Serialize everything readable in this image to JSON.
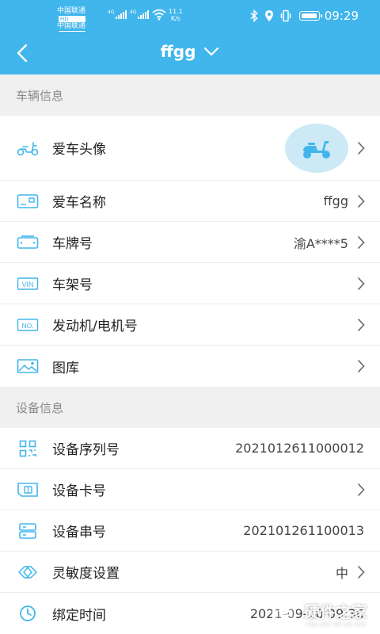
{
  "status_bar": {
    "carrier_1": "中国联通",
    "carrier_2": "中国联通",
    "hd_badge": "HD",
    "network_1": "4G",
    "network_2": "4G",
    "speed_value": "11.1",
    "speed_unit": "K/s",
    "time": "09:29"
  },
  "header": {
    "back_icon": "chevron-left-icon",
    "title": "ffgg",
    "dropdown_icon": "chevron-down-icon"
  },
  "vehicle_section": {
    "title": "车辆信息",
    "rows": [
      {
        "label": "爱车头像",
        "value": "",
        "icon": "scooter-icon"
      },
      {
        "label": "爱车名称",
        "value": "ffgg",
        "icon": "card-icon"
      },
      {
        "label": "车牌号",
        "value": "渝A****5",
        "icon": "license-plate-icon"
      },
      {
        "label": "车架号",
        "value": "",
        "icon": "vin-icon"
      },
      {
        "label": "发动机/电机号",
        "value": "",
        "icon": "engine-number-icon"
      },
      {
        "label": "图库",
        "value": "",
        "icon": "gallery-icon"
      }
    ]
  },
  "device_section": {
    "title": "设备信息",
    "rows": [
      {
        "label": "设备序列号",
        "value": "2021012611000012",
        "icon": "qr-code-icon"
      },
      {
        "label": "设备卡号",
        "value": "",
        "icon": "sim-card-icon"
      },
      {
        "label": "设备串号",
        "value": "202101261100013",
        "icon": "server-icon"
      },
      {
        "label": "灵敏度设置",
        "value": "中",
        "icon": "sensitivity-icon"
      },
      {
        "label": "绑定时间",
        "value": "2021-09-10 09:36",
        "icon": "clock-icon"
      }
    ]
  },
  "watermark": {
    "text": "硬件之家",
    "subtext": "YING JIAN ZHI JIA.COM"
  },
  "colors": {
    "header_bg": "#41b6ec",
    "icon_blue": "#41b6ec",
    "page_bg": "#f0f0f0",
    "section_text": "#8a8a8a",
    "avatar_bg": "#cde9f6"
  }
}
